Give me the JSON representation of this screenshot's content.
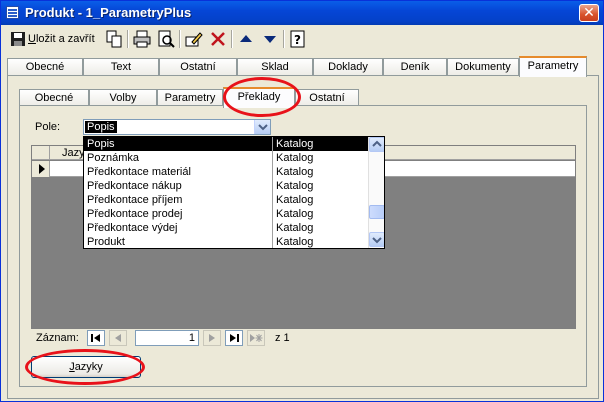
{
  "window": {
    "title": "Produkt - 1_ParametryPlus",
    "close_glyph": "✕"
  },
  "toolbar": {
    "save_label_prefix": "U",
    "save_label_rest": "ložit a zavřít",
    "icons": [
      "save-icon",
      "copy-icon",
      "print-icon",
      "print-preview-icon",
      "pencil-edit-icon",
      "delete-icon",
      "arrow-up-icon",
      "arrow-down-icon",
      "help-icon"
    ]
  },
  "outer_tabs": [
    {
      "label": "Obecné"
    },
    {
      "label": "Text"
    },
    {
      "label": "Ostatní"
    },
    {
      "label": "Sklad"
    },
    {
      "label": "Doklady"
    },
    {
      "label": "Deník"
    },
    {
      "label": "Dokumenty"
    },
    {
      "label": "Parametry",
      "active": true
    }
  ],
  "inner_tabs": [
    {
      "label": "Obecné"
    },
    {
      "label": "Volby"
    },
    {
      "label": "Parametry"
    },
    {
      "label": "Překlady",
      "active": true
    },
    {
      "label": "Ostatní"
    }
  ],
  "pole": {
    "label": "Pole:",
    "value": "Popis"
  },
  "datasheet": {
    "column": "Jazyk"
  },
  "dropdown": {
    "items": [
      {
        "name": "Popis",
        "type": "Katalog",
        "selected": true
      },
      {
        "name": "Poznámka",
        "type": "Katalog"
      },
      {
        "name": "Předkontace materiál",
        "type": "Katalog"
      },
      {
        "name": "Předkontace nákup",
        "type": "Katalog"
      },
      {
        "name": "Předkontace příjem",
        "type": "Katalog"
      },
      {
        "name": "Předkontace prodej",
        "type": "Katalog"
      },
      {
        "name": "Předkontace výdej",
        "type": "Katalog"
      },
      {
        "name": "Produkt",
        "type": "Katalog"
      }
    ]
  },
  "navigator": {
    "label": "Záznam:",
    "current": "1",
    "of_text": "z  1"
  },
  "jazyky_button": {
    "prefix": "J",
    "rest": "azyky"
  },
  "colors": {
    "title_bar": "#0546d6",
    "highlight_ring": "#e8121a",
    "active_tab_accent": "#e68b2c"
  }
}
